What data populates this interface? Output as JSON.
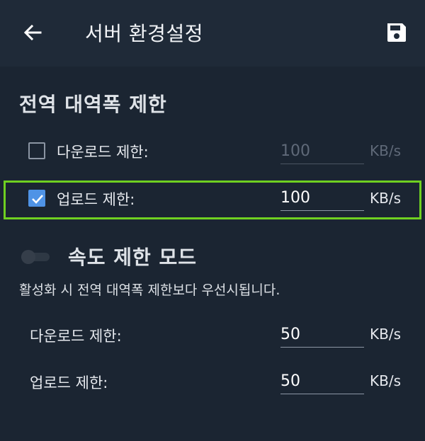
{
  "header": {
    "title": "서버 환경설정",
    "back_icon": "arrow-left-icon",
    "save_icon": "floppy-disk-icon"
  },
  "global_limits": {
    "title": "전역 대역폭 제한",
    "download": {
      "label": "다운로드 제한:",
      "value": "100",
      "unit": "KB/s",
      "checked": false
    },
    "upload": {
      "label": "업로드 제한:",
      "value": "100",
      "unit": "KB/s",
      "checked": true
    }
  },
  "speed_mode": {
    "title": "속도 제한 모드",
    "description": "활성화 시 전역 대역폭 제한보다 우선시됩니다.",
    "download": {
      "label": "다운로드 제한:",
      "value": "50",
      "unit": "KB/s"
    },
    "upload": {
      "label": "업로드 제한:",
      "value": "50",
      "unit": "KB/s"
    }
  },
  "colors": {
    "background": "#1b2532",
    "header": "#1f2a38",
    "accent": "#4f93e6",
    "highlight": "#6fd021"
  }
}
